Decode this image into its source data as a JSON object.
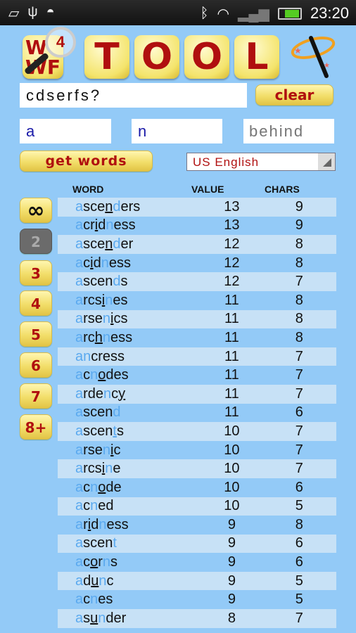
{
  "status_bar": {
    "time": "23:20",
    "icons_left": [
      "leaf-notification-icon",
      "usb-icon",
      "android-icon"
    ],
    "icons_right": [
      "bluetooth-icon",
      "wifi-icon",
      "signal-no-sim-icon",
      "battery-charging-icon"
    ]
  },
  "logo": {
    "tiles": [
      "T",
      "O",
      "O",
      "L"
    ],
    "wf_text": "W WF",
    "badge": "4"
  },
  "search": {
    "letters": "cdserfs?",
    "clear_label": "clear"
  },
  "filters": {
    "starts_with": "a",
    "contains": "n",
    "behind_placeholder": "behind"
  },
  "get_words_label": "get words",
  "language": "US English",
  "columns": {
    "word": "WORD",
    "value": "VALUE",
    "chars": "CHARS"
  },
  "length_buttons": [
    {
      "label": "∞"
    },
    {
      "label": "2",
      "selected": true
    },
    {
      "label": "3"
    },
    {
      "label": "4"
    },
    {
      "label": "5"
    },
    {
      "label": "6"
    },
    {
      "label": "7"
    },
    {
      "label": "8+"
    }
  ],
  "colors": {
    "highlight": "#5aa9ef",
    "button_text": "#b00f0f",
    "background": "#93caf7",
    "row_alt": "#c7e1f6"
  },
  "words": [
    {
      "word": "ascenders",
      "value": "13",
      "chars": "9",
      "blue": [
        0,
        5
      ],
      "under": 4
    },
    {
      "word": "acridness",
      "value": "13",
      "chars": "9",
      "blue": [
        0,
        5
      ],
      "under": 3
    },
    {
      "word": "ascender",
      "value": "12",
      "chars": "8",
      "blue": [
        0,
        5
      ],
      "under": 4
    },
    {
      "word": "acidness",
      "value": "12",
      "chars": "8",
      "blue": [
        0,
        4
      ],
      "under": 2
    },
    {
      "word": "ascends",
      "value": "12",
      "chars": "7",
      "blue": [
        0,
        5
      ],
      "under": -1
    },
    {
      "word": "arcsines",
      "value": "11",
      "chars": "8",
      "blue": [
        0,
        5
      ],
      "under": 4
    },
    {
      "word": "arsenics",
      "value": "11",
      "chars": "8",
      "blue": [
        0,
        4
      ],
      "under": 5
    },
    {
      "word": "archness",
      "value": "11",
      "chars": "8",
      "blue": [
        0,
        4
      ],
      "under": 3
    },
    {
      "word": "ancress",
      "value": "11",
      "chars": "7",
      "blue": [
        0,
        1
      ],
      "under": -1
    },
    {
      "word": "acnodes",
      "value": "11",
      "chars": "7",
      "blue": [
        0,
        2
      ],
      "under": 3
    },
    {
      "word": "ardency",
      "value": "11",
      "chars": "7",
      "blue": [
        0,
        4
      ],
      "under": 6
    },
    {
      "word": "ascend",
      "value": "11",
      "chars": "6",
      "blue": [
        0,
        5
      ],
      "under": -1
    },
    {
      "word": "ascents",
      "value": "10",
      "chars": "7",
      "blue": [
        0,
        5
      ],
      "under": 5
    },
    {
      "word": "arsenic",
      "value": "10",
      "chars": "7",
      "blue": [
        0,
        4
      ],
      "under": 5
    },
    {
      "word": "arcsine",
      "value": "10",
      "chars": "7",
      "blue": [
        0,
        5
      ],
      "under": 4
    },
    {
      "word": "acnode",
      "value": "10",
      "chars": "6",
      "blue": [
        0,
        2
      ],
      "under": 3
    },
    {
      "word": "acned",
      "value": "10",
      "chars": "5",
      "blue": [
        0,
        2
      ],
      "under": -1
    },
    {
      "word": "aridness",
      "value": "9",
      "chars": "8",
      "blue": [
        0,
        4
      ],
      "under": 2
    },
    {
      "word": "ascent",
      "value": "9",
      "chars": "6",
      "blue": [
        0,
        5
      ],
      "under": -1
    },
    {
      "word": "acorns",
      "value": "9",
      "chars": "6",
      "blue": [
        0,
        4
      ],
      "under": 2
    },
    {
      "word": "adunc",
      "value": "9",
      "chars": "5",
      "blue": [
        0,
        3
      ],
      "under": 2
    },
    {
      "word": "acnes",
      "value": "9",
      "chars": "5",
      "blue": [
        0,
        2
      ],
      "under": -1
    },
    {
      "word": "asunder",
      "value": "8",
      "chars": "7",
      "blue": [
        0,
        3
      ],
      "under": 2
    }
  ]
}
